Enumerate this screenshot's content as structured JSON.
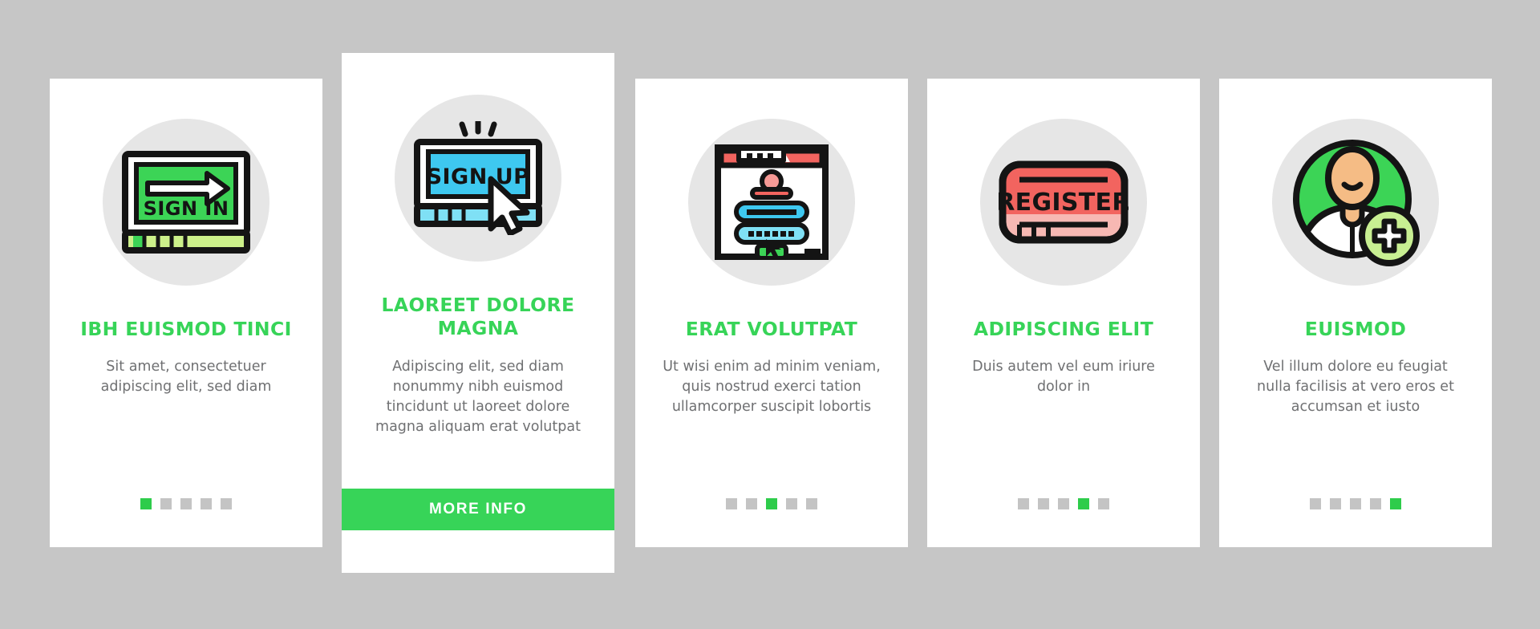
{
  "page": {
    "background_color": "#c6c6c6",
    "accent_green": "#37d458",
    "dot_active_color": "#2ecc4b",
    "dot_inactive_color": "#c4c4c4",
    "body_text_color": "#6f7072",
    "icon_disc_color": "#e6e6e6"
  },
  "cards": [
    {
      "icon_name": "sign-in-screen-icon",
      "icon_label": "SIGN IN",
      "title": "IBH EUISMOD TINCI",
      "body": "Sit amet, consectetuer adipiscing elit, sed diam",
      "dots": {
        "count": 5,
        "active_index": 0
      },
      "cta": null
    },
    {
      "icon_name": "sign-up-screen-cursor-icon",
      "icon_label": "SIGN UP",
      "title": "LAOREET DOLORE MAGNA",
      "body": "Adipiscing elit, sed diam nonummy nibh euismod tincidunt ut laoreet dolore magna aliquam erat volutpat",
      "dots": null,
      "cta": "MORE INFO"
    },
    {
      "icon_name": "login-form-browser-window-icon",
      "icon_label": "",
      "title": "ERAT VOLUTPAT",
      "body": "Ut wisi enim ad minim veniam, quis nostrud exerci tation ullamcorper suscipit lobortis",
      "dots": {
        "count": 5,
        "active_index": 2
      },
      "cta": null
    },
    {
      "icon_name": "register-button-icon",
      "icon_label": "REGISTER",
      "title": "ADIPISCING ELIT",
      "body": "Duis autem vel eum iriure dolor in",
      "dots": {
        "count": 5,
        "active_index": 3
      },
      "cta": null
    },
    {
      "icon_name": "add-user-avatar-icon",
      "icon_label": "",
      "title": "EUISMOD",
      "body": "Vel illum dolore eu feugiat nulla facilisis at vero eros et accumsan et iusto",
      "dots": {
        "count": 5,
        "active_index": 4
      },
      "cta": null
    }
  ]
}
